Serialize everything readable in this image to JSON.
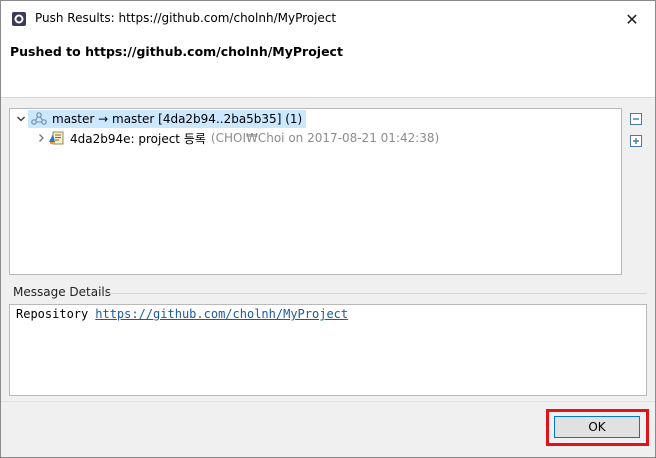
{
  "window": {
    "title": "Push Results: https://github.com/cholnh/MyProject",
    "close_glyph": "✕"
  },
  "header": {
    "headline": "Pushed to https://github.com/cholnh/MyProject"
  },
  "tree": {
    "rows": [
      {
        "expanded": true,
        "label": "master → master [4da2b94..2ba5b35] (1)",
        "icon": "branch-push-icon",
        "selected": true
      },
      {
        "expanded": false,
        "label": "4da2b94e: project 등록",
        "meta": "(CHOI₩Choi on 2017-08-21 01:42:38)",
        "icon": "commit-icon"
      }
    ]
  },
  "side_buttons": [
    {
      "name": "collapse-all-icon"
    },
    {
      "name": "expand-all-icon"
    }
  ],
  "message_details": {
    "label": "Message Details",
    "prefix": "Repository",
    "link": "https://github.com/cholnh/MyProject"
  },
  "footer": {
    "ok_label": "OK"
  },
  "colors": {
    "selection": "#cce8ff",
    "link": "#1a5aa6",
    "highlight_box": "#e0121a",
    "ok_border": "#0078d7"
  }
}
